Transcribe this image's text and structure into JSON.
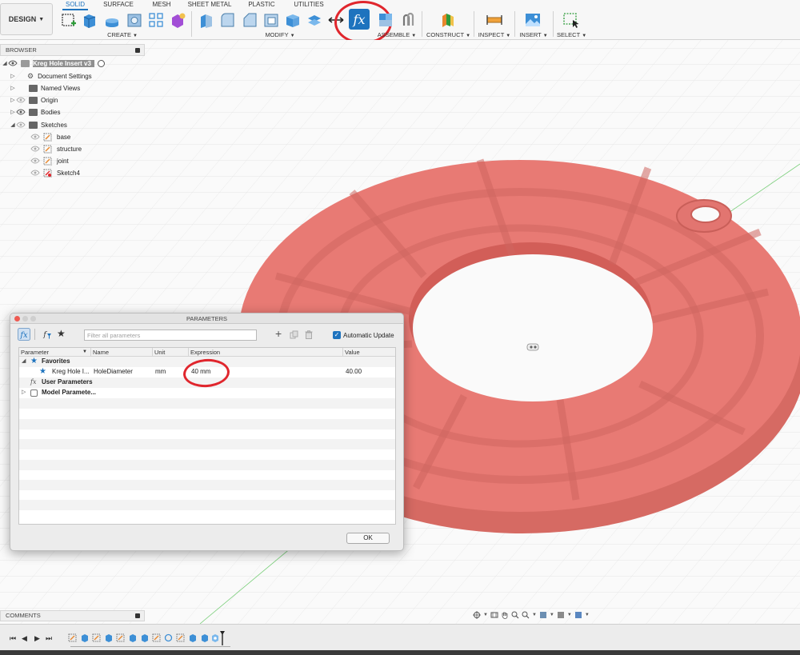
{
  "toolbar": {
    "design_label": "DESIGN",
    "tabs": [
      "SOLID",
      "SURFACE",
      "MESH",
      "SHEET METAL",
      "PLASTIC",
      "UTILITIES"
    ],
    "groups": {
      "create": "CREATE",
      "modify": "MODIFY",
      "assemble": "ASSEMBLE",
      "construct": "CONSTRUCT",
      "inspect": "INSPECT",
      "insert": "INSERT",
      "select": "SELECT"
    },
    "accent_color": "#1e73be",
    "annotation_color": "#e0262d"
  },
  "browser": {
    "title": "BROWSER",
    "root": "Kreg Hole Insert v3",
    "items": [
      "Document Settings",
      "Named Views",
      "Origin",
      "Bodies",
      "Sketches"
    ],
    "sketches": [
      "base",
      "structure",
      "joint",
      "Sketch4"
    ]
  },
  "parameters": {
    "title": "PARAMETERS",
    "filter_placeholder": "Filter all parameters",
    "auto_update_label": "Automatic Update",
    "columns": [
      "Parameter",
      "Name",
      "Unit",
      "Expression",
      "Value"
    ],
    "groups": {
      "favorites": "Favorites",
      "user": "User Parameters",
      "model": "Model Paramete..."
    },
    "favorite_row": {
      "parameter": "Kreg Hole I...",
      "name": "HoleDiameter",
      "unit": "mm",
      "expression": "40 mm",
      "value": "40.00"
    },
    "ok_label": "OK"
  },
  "comments": {
    "title": "COMMENTS"
  },
  "model": {
    "color": "#e87a74"
  }
}
